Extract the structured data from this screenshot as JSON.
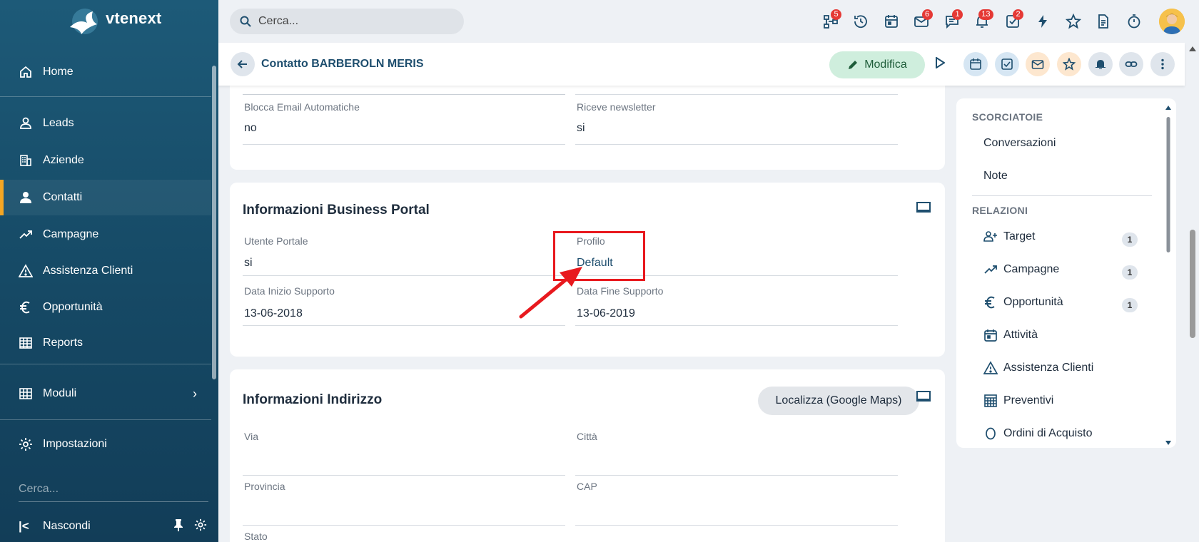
{
  "app": {
    "name": "vtenext"
  },
  "sidebar": {
    "items": [
      {
        "label": "Home",
        "icon": "home-icon"
      },
      {
        "label": "Leads",
        "icon": "user-outline-icon"
      },
      {
        "label": "Aziende",
        "icon": "building-icon"
      },
      {
        "label": "Contatti",
        "icon": "user-icon"
      },
      {
        "label": "Campagne",
        "icon": "trend-icon"
      },
      {
        "label": "Assistenza Clienti",
        "icon": "warning-icon"
      },
      {
        "label": "Opportunità",
        "icon": "euro-icon"
      },
      {
        "label": "Reports",
        "icon": "table-icon"
      },
      {
        "label": "Moduli",
        "icon": "grid-icon"
      },
      {
        "label": "Impostazioni",
        "icon": "gear-icon"
      }
    ],
    "active": "Contatti",
    "search_placeholder": "Cerca...",
    "hide_label": "Nascondi"
  },
  "topbar": {
    "search_placeholder": "Cerca...",
    "badges": {
      "network": "5",
      "mail": "6",
      "chat": "1",
      "bell": "13",
      "tasks": "2"
    }
  },
  "header": {
    "title": "Contatto BARBEROLN MERIS",
    "edit_label": "Modifica"
  },
  "sections": {
    "email_prefs": {
      "left_label": "Blocca Email Automatiche",
      "left_value": "no",
      "right_label": "Riceve newsletter",
      "right_value": "si"
    },
    "portal": {
      "title": "Informazioni Business Portal",
      "fields": [
        {
          "label": "Utente Portale",
          "value": "si"
        },
        {
          "label": "Profilo",
          "value": "Default"
        },
        {
          "label": "Data Inizio Supporto",
          "value": "13-06-2018"
        },
        {
          "label": "Data Fine Supporto",
          "value": "13-06-2019"
        }
      ]
    },
    "address": {
      "title": "Informazioni Indirizzo",
      "maps_button": "Localizza (Google Maps)",
      "fields": [
        {
          "label": "Via",
          "value": ""
        },
        {
          "label": "Città",
          "value": ""
        },
        {
          "label": "Provincia",
          "value": ""
        },
        {
          "label": "CAP",
          "value": ""
        },
        {
          "label": "Stato",
          "value": ""
        }
      ]
    }
  },
  "right_panel": {
    "shortcuts_title": "SCORCIATOIE",
    "shortcuts": [
      "Conversazioni",
      "Note"
    ],
    "relations_title": "RELAZIONI",
    "relations": [
      {
        "label": "Target",
        "count": "1",
        "icon": "users-plus-icon"
      },
      {
        "label": "Campagne",
        "count": "1",
        "icon": "trend-icon"
      },
      {
        "label": "Opportunità",
        "count": "1",
        "icon": "euro-icon"
      },
      {
        "label": "Attività",
        "count": "",
        "icon": "calendar-icon"
      },
      {
        "label": "Assistenza Clienti",
        "count": "",
        "icon": "warning-icon"
      },
      {
        "label": "Preventivi",
        "count": "",
        "icon": "calculator-icon"
      },
      {
        "label": "Ordini di Acquisto",
        "count": "",
        "icon": "circle-icon"
      }
    ]
  },
  "colors": {
    "sidebar": "#164a66",
    "accent": "#f5a623",
    "annotation": "#e8191e",
    "title": "#1e4e6e"
  }
}
